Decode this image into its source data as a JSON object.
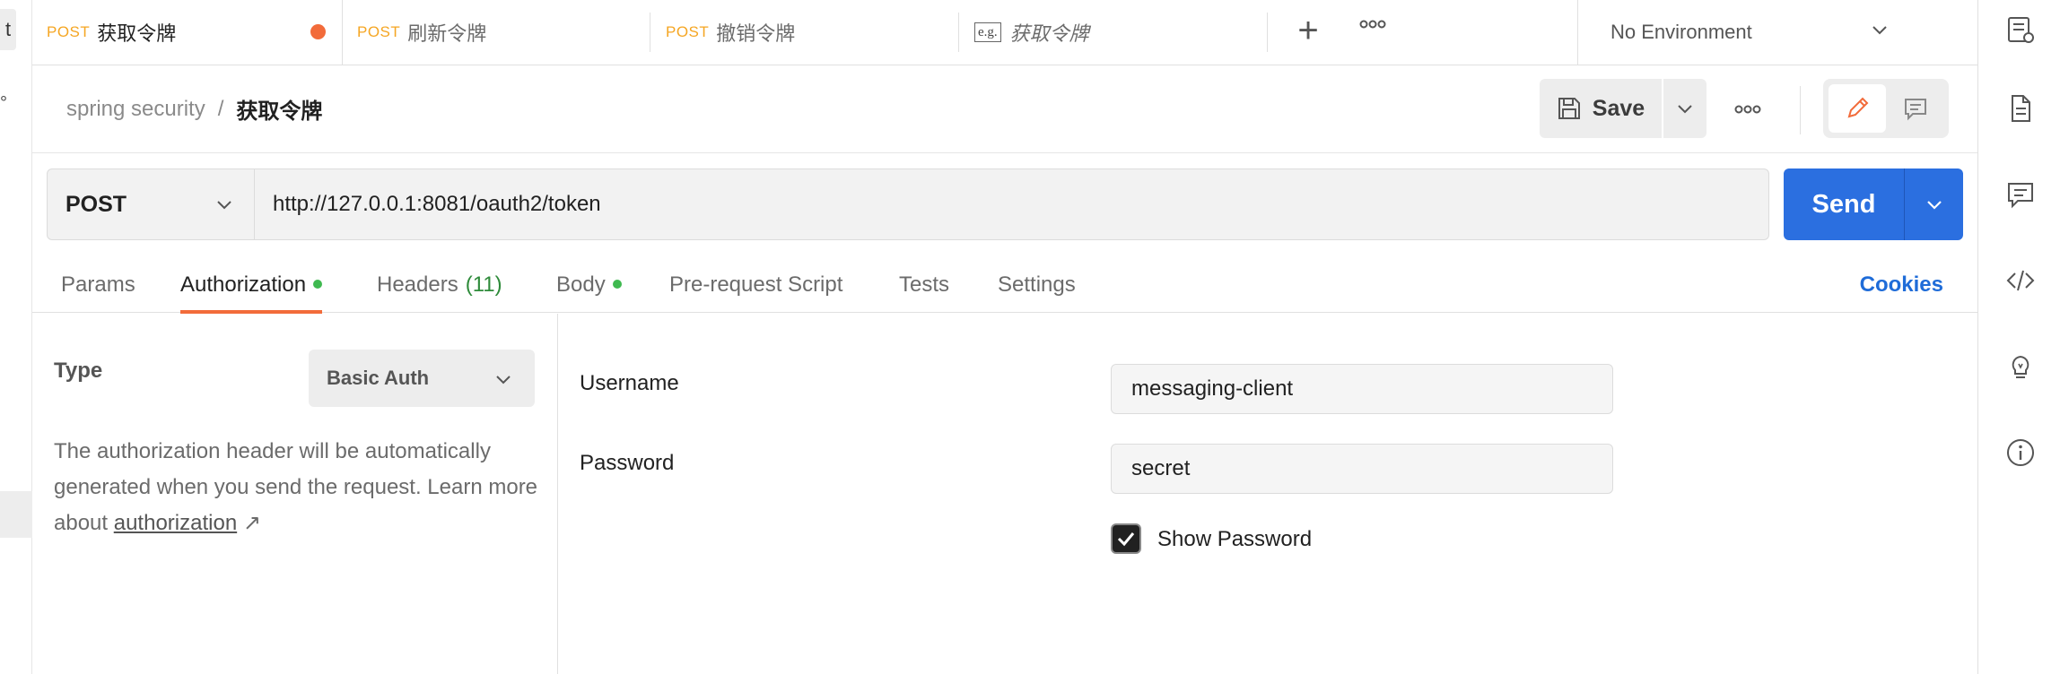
{
  "left_strip": {
    "cut_tab_text": "t",
    "dot_text": "°"
  },
  "tabs": [
    {
      "method": "POST",
      "name": "获取令牌",
      "active": true,
      "unsaved": true
    },
    {
      "method": "POST",
      "name": "刷新令牌"
    },
    {
      "method": "POST",
      "name": "撤销令牌"
    },
    {
      "badge": "e.g.",
      "name": "获取令牌",
      "example": true
    }
  ],
  "environment": {
    "label": "No Environment"
  },
  "breadcrumb": {
    "collection": "spring security",
    "separator": "/",
    "request": "获取令牌"
  },
  "toolbar": {
    "save_label": "Save"
  },
  "request": {
    "method": "POST",
    "url": "http://127.0.0.1:8081/oauth2/token",
    "send_label": "Send"
  },
  "subtabs": {
    "params": "Params",
    "authorization": "Authorization",
    "headers": "Headers",
    "headers_count": "(11)",
    "body": "Body",
    "prerequest": "Pre-request Script",
    "tests": "Tests",
    "settings": "Settings",
    "cookies": "Cookies"
  },
  "auth": {
    "type_label": "Type",
    "type_value": "Basic Auth",
    "description": "The authorization header will be automatically generated when you send the request. Learn more about ",
    "link_text": "authorization",
    "link_arrow": "↗",
    "username_label": "Username",
    "username_value": "messaging-client",
    "password_label": "Password",
    "password_value": "secret",
    "show_password_label": "Show Password",
    "show_password_checked": true
  },
  "colors": {
    "accent": "#f26b3a",
    "send": "#2b6fe0",
    "method_post": "#f5a623",
    "link": "#1f6cd8",
    "dot_green": "#3fb950"
  },
  "icons": {
    "right_rail": [
      "documentation-icon",
      "comments-icon",
      "code-icon",
      "lightbulb-icon",
      "info-icon"
    ]
  }
}
